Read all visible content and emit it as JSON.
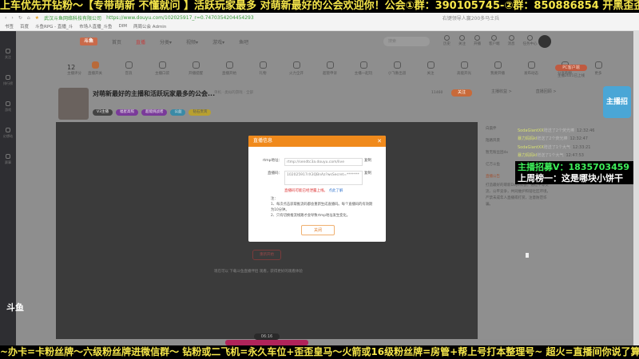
{
  "top_banner": "上车优先开钻粉～【专带萌新 不懂就问 】活跃玩家最多 对萌新最好的公会欢迎你！公会①群：390105745-②群：850886854  开黑歪歪：84907",
  "bottom_banner": "~办卡=卡粉丝牌～六级粉丝牌进微信群～ 钻粉或二飞机=永久车位+歪歪皇马～火箭或16级粉丝牌=房管+帮上号打本整理号~  超火=直播间你说了算",
  "browser": {
    "site": "武汉斗鱼网络科技有限公司",
    "url": "https://www.douyu.com/102025917_r=0.7470354204454293",
    "search_hint": "右键领导人赢200多马士兵",
    "bookmarks": [
      "书签",
      "百度",
      "斗鱼RPG - 直播_斗",
      "市场人直播_斗鱼",
      "DIM",
      "两周公会 Admin"
    ]
  },
  "sidebar": {
    "items": [
      "关注",
      "排行榜",
      "游戏",
      "幻想站",
      "赛事"
    ]
  },
  "nav": {
    "logo": "斗鱼",
    "items": [
      "首页",
      "直播",
      "分类▾",
      "视频▾",
      "游戏▾",
      "鱼吧"
    ],
    "search_placeholder": "搜索",
    "top_icons": [
      "历史",
      "关注",
      "开播",
      "客户端",
      "消息",
      "任务中心"
    ]
  },
  "icon_row": {
    "fans": "12",
    "fans_label": "主播评分",
    "items": [
      "直播开关",
      "音浪",
      "主播口袋",
      "开播提醒",
      "直播开始",
      "礼物",
      "火力全开",
      "超管申诉",
      "主播一起玩",
      "小飞象出道",
      "关注",
      "高能开光",
      "我要开播",
      "发布动态",
      "分享购物",
      "更多"
    ],
    "pc_button": "PC客户端",
    "pc_sub": "主播2021已上线"
  },
  "room": {
    "title": "对萌新最好的主播和活跃玩家最多的公会...",
    "meta": "单机 · 类似的游戏 · 全部",
    "tags": [
      "V3主播",
      "福星高照",
      "超能挑战者",
      "公益",
      "钻石贵宾"
    ],
    "follow_count": "11460",
    "follow": "关注",
    "rank_buttons": [
      "主播收益 >",
      "直播回顾 >"
    ]
  },
  "video": {
    "start_button": "重新开始",
    "tip": "现在可以 下载斗鱼直播伴侣 观看，获得更好的观看体验",
    "timer": "06:16",
    "watermark": "斗鱼"
  },
  "modal": {
    "title": "直播信息",
    "rtmp_label": "rtmp地址：",
    "rtmp_value": "rtmp://sendtc3a.douyu.com/live",
    "key_label": "直播码：",
    "key_value": "102025917rX3QBnAz?wsSecret=*******",
    "copy": "复制",
    "warn": "直播码可能已经泄露上线。",
    "warn_link": "点此了解",
    "notes": [
      "注：",
      "1、每次点击获取推流码都会重新生成直播码。每个直播码的有效期为10分钟。",
      "2、只有切换推流线路才会导致rtmp地址发生变化。"
    ],
    "ok": "关闭"
  },
  "chat": {
    "names": [
      "白晨伴",
      "陌路风景",
      "暂无粉丝团dx",
      "亿万斗鱼"
    ],
    "messages": [
      {
        "user": "SodaGiantXX",
        "text": "赠送了2个荧光棒",
        "time": "12:32:46"
      },
      {
        "user": "暴力妈妈kl",
        "text": "赠送了2个荧光棒",
        "time": "12:32:47"
      },
      {
        "user": "SodaGiantXX",
        "text": "赠送了1个大气",
        "time": "12:33:21"
      },
      {
        "user": "暴力妈妈kl",
        "text": "赠送了1个大气",
        "time": "12:47:53"
      }
    ],
    "notice_title": "直播公告",
    "notice": "打造最好的萌新Dayz公会，通过平等交流、公平竞争，共同维护和谐社区环境，严禁未成年人直播或打赏，注意防范诈骗。"
  },
  "overlays": {
    "recruit": "主播招募V：1835703459",
    "last_week_top": "上周榜一：这是哪块小饼干"
  },
  "mascot": "主播招募"
}
